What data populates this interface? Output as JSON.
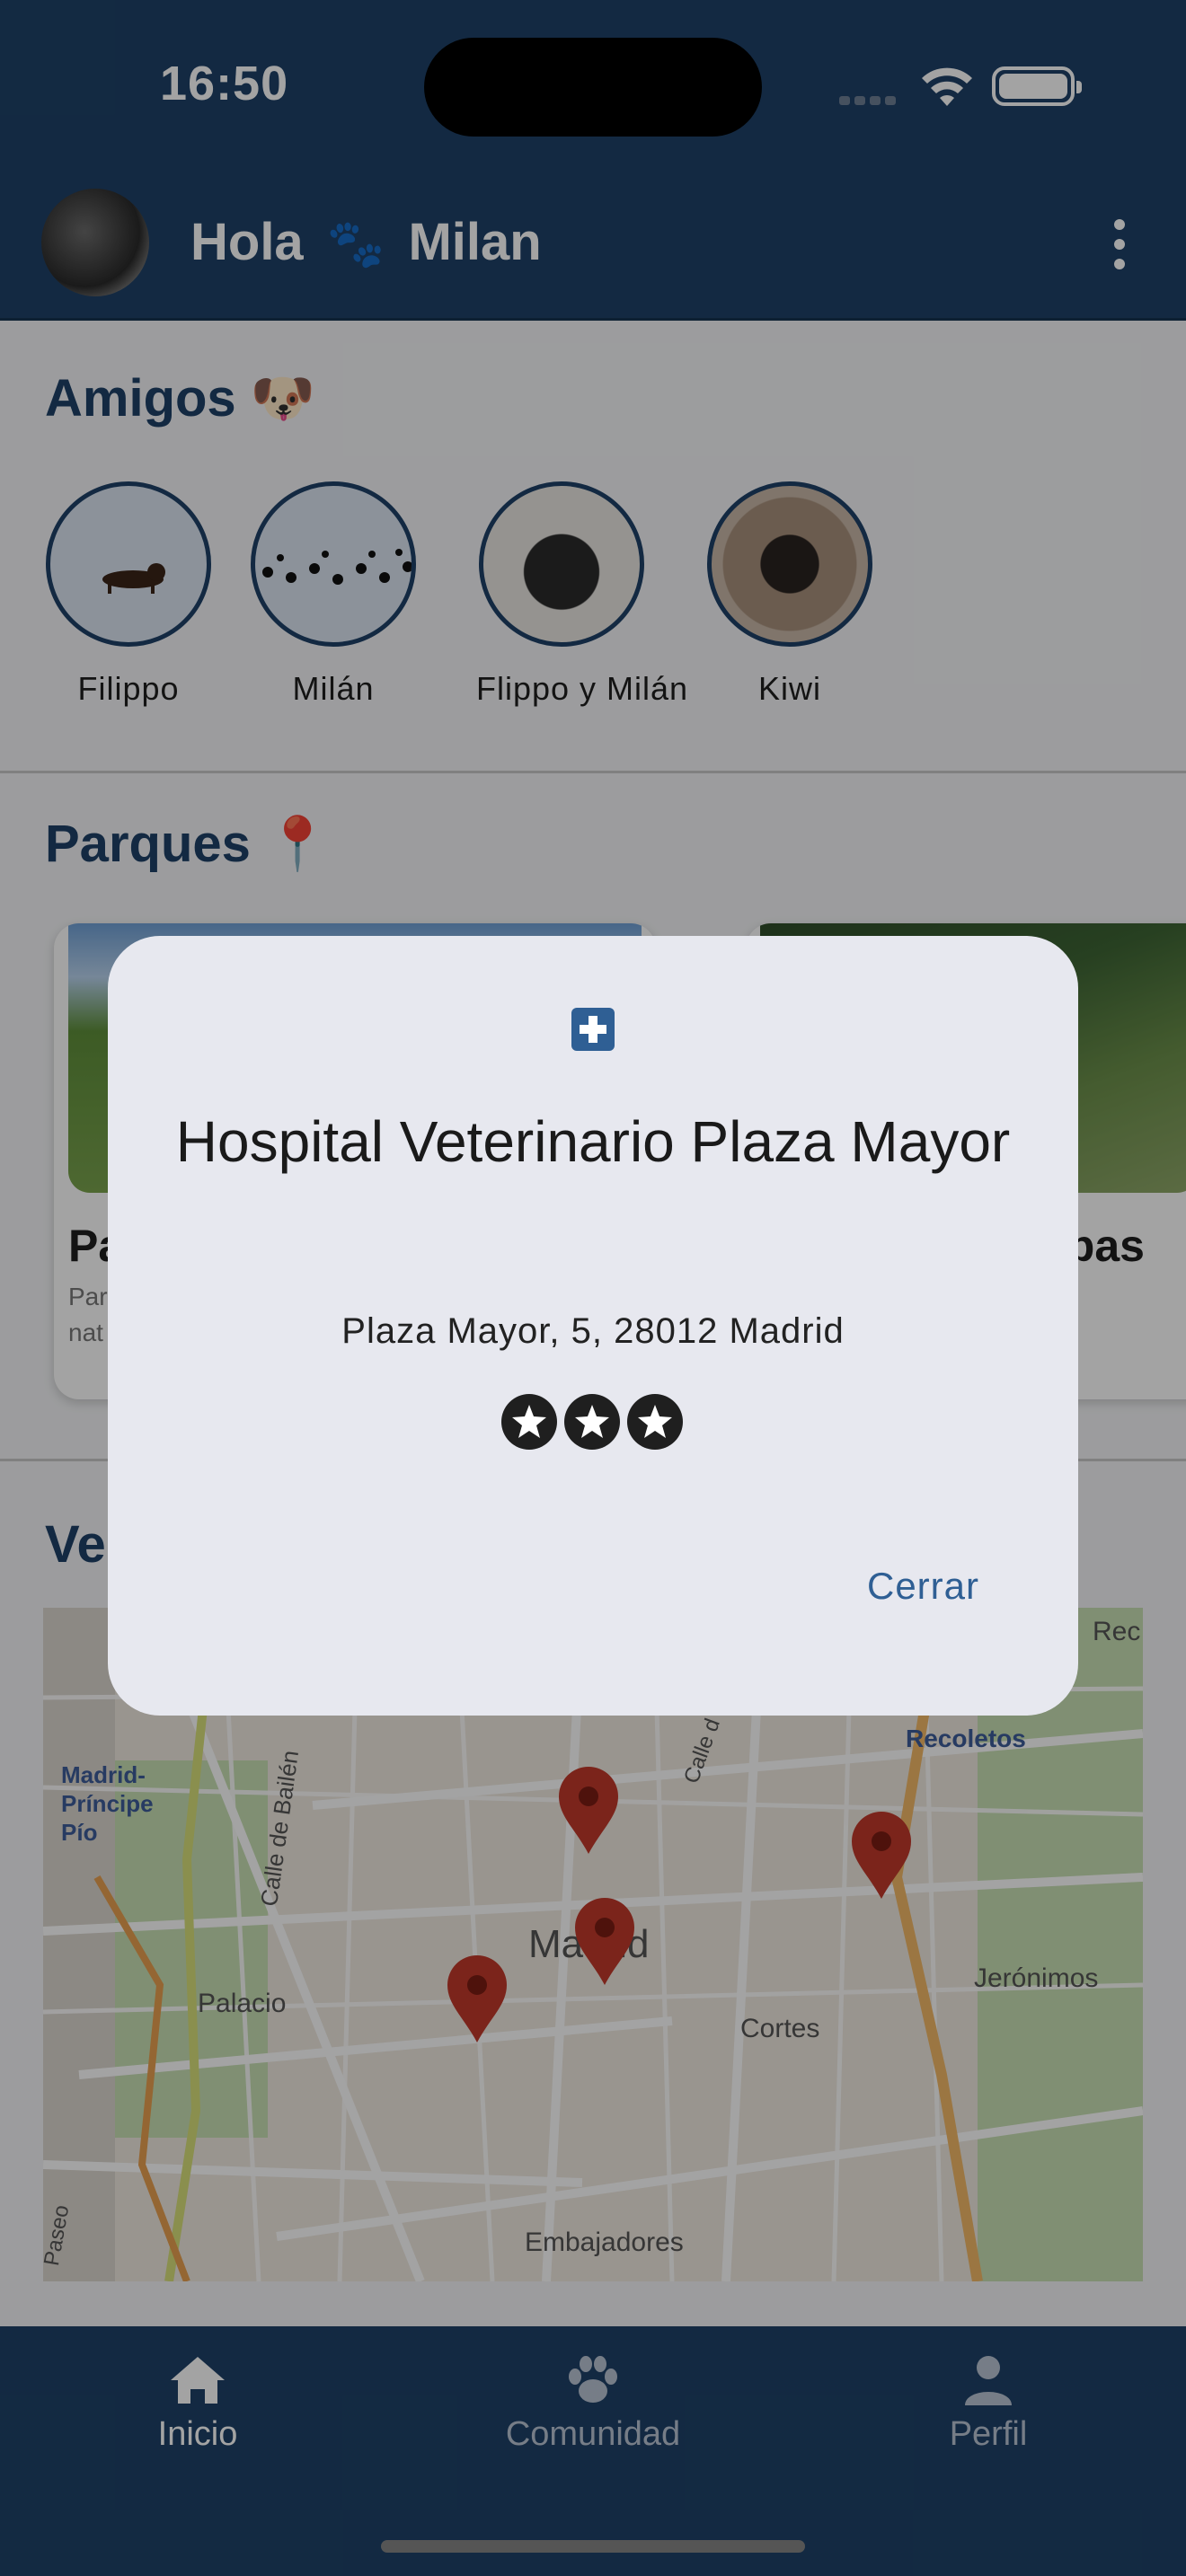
{
  "status_bar": {
    "time": "16:50"
  },
  "header": {
    "greeting": "Hola",
    "paw_glyph": "🐾",
    "user_name": "Milan"
  },
  "friends": {
    "title": "Amigos",
    "title_emoji": "🐶",
    "items": [
      {
        "name": "Filippo"
      },
      {
        "name": "Milán"
      },
      {
        "name": "Flippo y Milán"
      },
      {
        "name": "Kiwi"
      }
    ]
  },
  "parks": {
    "title": "Parques",
    "title_emoji": "📍",
    "cards": [
      {
        "title_fragment": "Pa",
        "desc_fragment_1": "Par",
        "desc_fragment_2": "nat"
      },
      {
        "title_fragment": "ebas"
      }
    ]
  },
  "vets": {
    "title_fragment": "Ve",
    "map_labels": {
      "madrid_principe_pio": "Madrid-\nPríncipe\nPío",
      "recoletos": "Recoletos",
      "madrid": "Madrid",
      "palacio": "Palacio",
      "cortes": "Cortes",
      "jeronimos": "Jerónimos",
      "embajadores": "Embajadores",
      "calle_bailen": "Calle de Bailén",
      "rec": "Rec",
      "paseo": "Paseo",
      "calle_d": "Calle d"
    }
  },
  "bottom_nav": {
    "items": [
      {
        "label": "Inicio",
        "icon": "home-icon"
      },
      {
        "label": "Comunidad",
        "icon": "paw-icon"
      },
      {
        "label": "Perfil",
        "icon": "person-icon"
      }
    ]
  },
  "dialog": {
    "icon": "hospital-cross-icon",
    "title": "Hospital Veterinario Plaza Mayor",
    "address": "Plaza Mayor, 5, 28012 Madrid",
    "rating_stars": 3,
    "close_label": "Cerrar"
  },
  "colors": {
    "header_bg": "#1e4168",
    "accent": "#2f5f94",
    "pin_red": "#c0392b",
    "dialog_bg": "#e7e8ef"
  }
}
